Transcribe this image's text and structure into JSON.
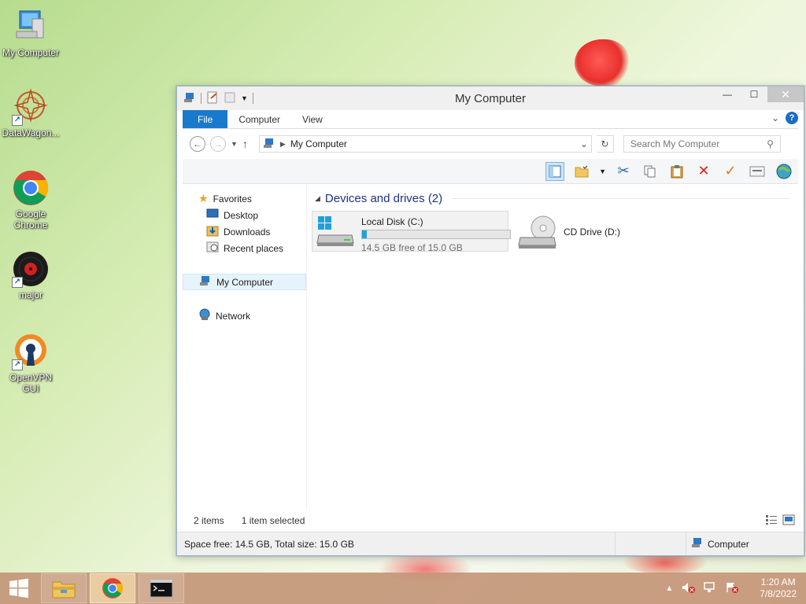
{
  "desktop": {
    "icons": [
      {
        "label": "My Computer",
        "icon": "computer-icon"
      },
      {
        "label": "DataWagon...",
        "icon": "datawagon-icon"
      },
      {
        "label": "Google Chrome",
        "icon": "chrome-icon"
      },
      {
        "label": "major",
        "icon": "record-icon"
      },
      {
        "label": "OpenVPN GUI",
        "icon": "openvpn-icon"
      }
    ]
  },
  "window": {
    "title": "My Computer",
    "controls": {
      "minimize": "—",
      "maximize": "☐",
      "close": "✕"
    },
    "ribbon_tabs": [
      {
        "label": "File"
      },
      {
        "label": "Computer"
      },
      {
        "label": "View"
      }
    ],
    "address": {
      "path": "My Computer"
    },
    "search": {
      "placeholder": "Search My Computer"
    },
    "nav": {
      "favorites": "Favorites",
      "desktop": "Desktop",
      "downloads": "Downloads",
      "recent": "Recent places",
      "my_computer": "My Computer",
      "network": "Network"
    },
    "group": {
      "title": "Devices and drives (2)"
    },
    "drives": [
      {
        "name": "Local Disk (C:)",
        "free_text": "14.5 GB free of 15.0 GB",
        "used_fraction": 0.033
      },
      {
        "name": "CD Drive (D:)"
      }
    ],
    "status": {
      "items": "2 items",
      "selected": "1 item selected"
    },
    "details": {
      "space": "Space free: 14.5 GB, Total size: 15.0 GB",
      "location": "Computer"
    }
  },
  "taskbar": {
    "clock": {
      "time": "1:20 AM",
      "date": "7/8/2022"
    }
  },
  "colors": {
    "accent": "#1979ca",
    "group_header": "#1e3287",
    "drive_bar": "#26a0da",
    "taskbar": "#c49678"
  }
}
